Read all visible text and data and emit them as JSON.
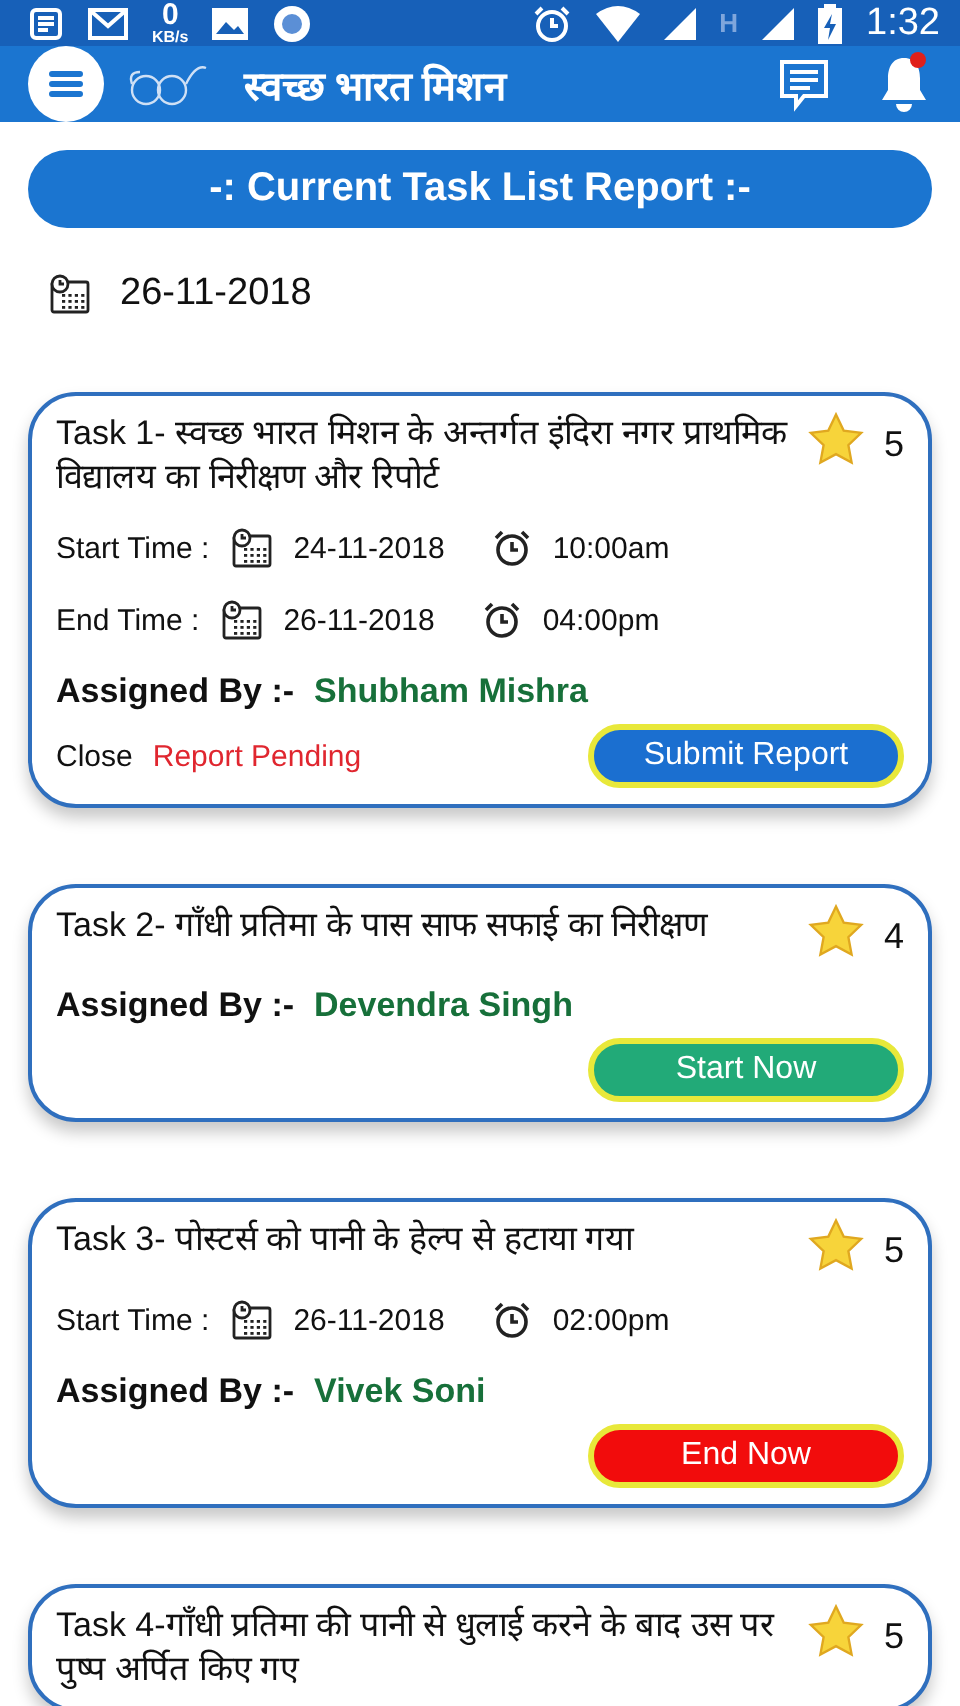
{
  "status_bar": {
    "net_speed_value": "0",
    "net_speed_unit": "KB/s",
    "network_type": "H",
    "time": "1:32"
  },
  "app_bar": {
    "title": "स्वच्छ भारत मिशन",
    "notification_badge": true
  },
  "report_header": "-: Current Task List Report :-",
  "report_date": "26-11-2018",
  "tasks": [
    {
      "title": "Task 1- स्वच्छ भारत मिशन के अन्तर्गत इंदिरा नगर प्राथमिक विद्यालय का निरीक्षण और रिपोर्ट",
      "rating": "5",
      "start": {
        "label": "Start Time :",
        "date": "24-11-2018",
        "time": "10:00am"
      },
      "end": {
        "label": "End Time :",
        "date": "26-11-2018",
        "time": "04:00pm"
      },
      "assigned_label": "Assigned By :-",
      "assigned_by": "Shubham Mishra",
      "status_label": "Close",
      "status": "Report Pending",
      "button": {
        "kind": "submit",
        "label": "Submit Report"
      }
    },
    {
      "title": "Task 2- गाँधी प्रतिमा के पास साफ सफाई का निरीक्षण",
      "rating": "4",
      "assigned_label": "Assigned By :-",
      "assigned_by": "Devendra Singh",
      "button": {
        "kind": "start",
        "label": "Start Now"
      }
    },
    {
      "title": "Task 3- पोस्टर्स को पानी के हेल्प से हटाया गया",
      "rating": "5",
      "start": {
        "label": "Start Time :",
        "date": "26-11-2018",
        "time": "02:00pm"
      },
      "assigned_label": "Assigned By :-",
      "assigned_by": "Vivek Soni",
      "button": {
        "kind": "end",
        "label": "End Now"
      }
    },
    {
      "title": "Task 4-गाँधी प्रतिमा की पानी से धुलाई करने के बाद उस पर पुष्प अर्पित किए गए",
      "rating": "5"
    }
  ]
}
